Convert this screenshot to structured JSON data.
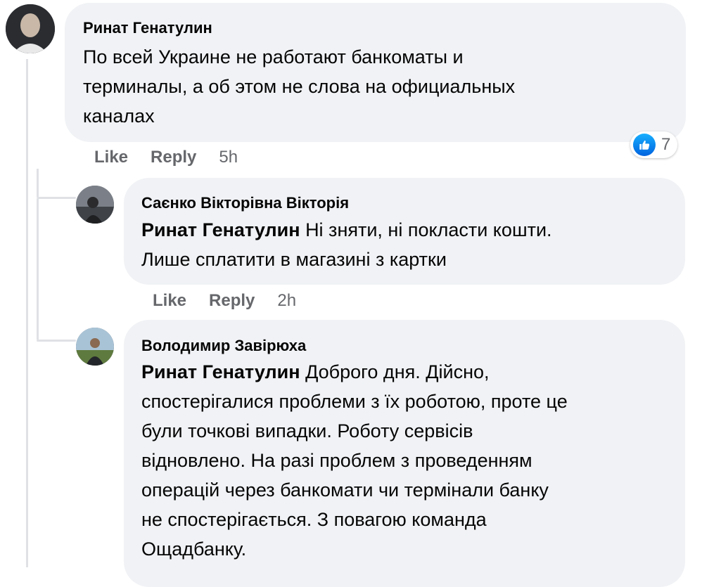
{
  "comments": [
    {
      "author": "Ринат Генатулин",
      "text": "По всей Украине не работают банкоматы и терминалы, а об этом не слова на официальных каналах",
      "text_lines": [
        "По всей Украине не работают банкоматы и",
        "терминалы, а об этом не слова на официальных",
        "каналах"
      ],
      "like_label": "Like",
      "reply_label": "Reply",
      "time": "5h",
      "reaction_count": "7",
      "reaction_icon": "thumbs-up-icon"
    },
    {
      "author": "Саєнко Вікторівна Вікторія",
      "mention": "Ринат Генатулин",
      "text_lines": [
        "Ні зняти, ні покласти кошти.",
        "Лише сплатити в магазині з картки"
      ],
      "like_label": "Like",
      "reply_label": "Reply",
      "time": "2h"
    },
    {
      "author": "Володимир Завірюха",
      "mention": "Ринат Генатулин",
      "text_lines": [
        "Доброго дня. Дійсно,",
        "спостерігалися проблеми з їх роботою, проте це",
        "були точкові випадки. Роботу сервісів",
        "відновлено. На разі проблем з проведенням",
        "операцій через банкомати чи термінали банку",
        "не спостерігається. З повагою команда",
        "Ощадбанку."
      ]
    }
  ],
  "colors": {
    "bubble": "#f0f2f5",
    "muted": "#65676b",
    "like_blue": "#0866ff",
    "thread_line": "#dfe1e5"
  }
}
